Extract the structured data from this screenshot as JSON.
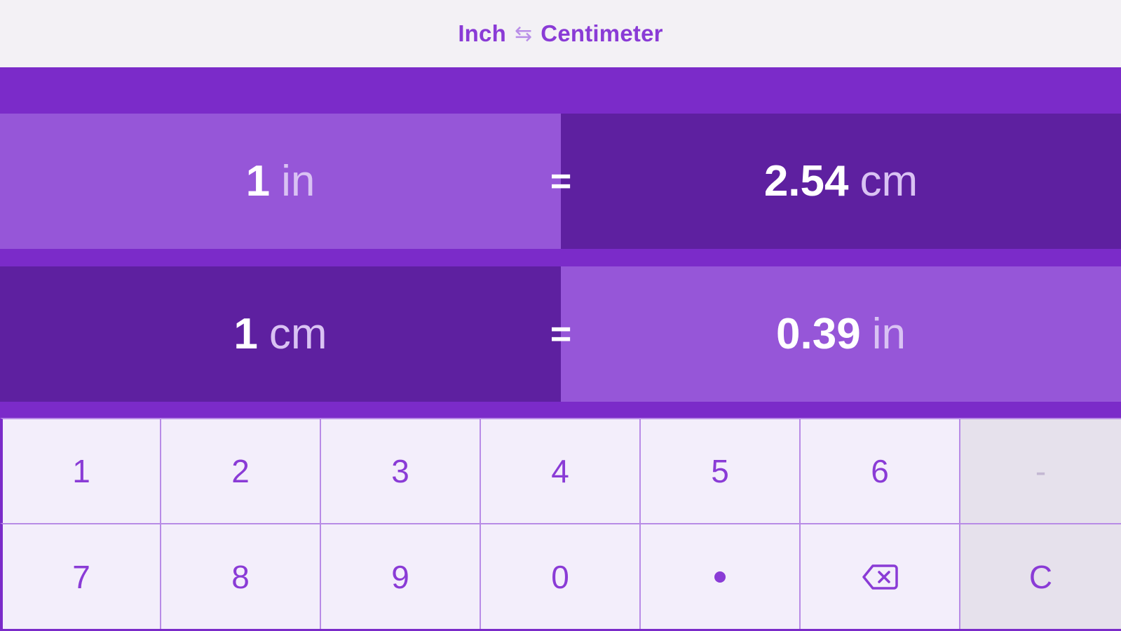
{
  "header": {
    "title_from": "Inch",
    "swap_icon": "⇆",
    "title_to": "Centimeter"
  },
  "conversions": [
    {
      "from_value": "1",
      "from_unit": "in",
      "equals": "=",
      "to_value": "2.54",
      "to_unit": "cm"
    },
    {
      "from_value": "1",
      "from_unit": "cm",
      "equals": "=",
      "to_value": "0.39",
      "to_unit": "in"
    }
  ],
  "keypad": {
    "row1": [
      "1",
      "2",
      "3",
      "4",
      "5",
      "6",
      "-"
    ],
    "row2": [
      "7",
      "8",
      "9",
      "0",
      "•",
      "backspace-icon",
      "C"
    ]
  },
  "colors": {
    "accent": "#7b2bc9",
    "light_cell": "#9656d8",
    "dark_cell": "#5e20a0",
    "key_text": "#8a3bd6",
    "titlebar": "#f3f1f5"
  }
}
